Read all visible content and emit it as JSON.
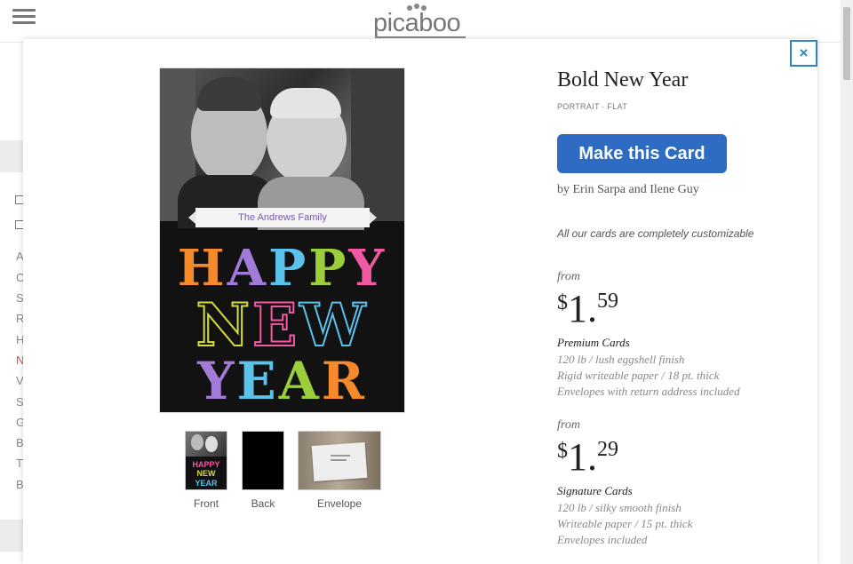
{
  "header": {
    "logo_text": "picaboo"
  },
  "sidebar_fragments": [
    "A",
    "C",
    "S",
    "R",
    "H",
    "N",
    "V",
    "S",
    "G",
    "B",
    "T",
    "B"
  ],
  "modal": {
    "close_label": "×",
    "card": {
      "family_banner": "The Andrews Family",
      "line1": "HAPPY",
      "line2": "NEW",
      "line3": "YEAR",
      "line1_colors": [
        "#f58a2d",
        "#a27bd9",
        "#5bc2ec",
        "#9ccd3a",
        "#ef5aa3"
      ],
      "line2_colors": [
        "#d6dd3a",
        "#ef5aa3",
        "#5bc2ec"
      ],
      "line3_colors": [
        "#a27bd9",
        "#5bc2ec",
        "#9ccd3a",
        "#f58a2d"
      ]
    },
    "thumbnails": [
      {
        "label": "Front"
      },
      {
        "label": "Back"
      },
      {
        "label": "Envelope"
      }
    ],
    "product": {
      "title": "Bold New Year",
      "subtitle": "PORTRAIT · FLAT",
      "cta_label": "Make this Card",
      "byline": "by Erin Sarpa and Ilene Guy",
      "custom_note": "All our cards are completely customizable"
    },
    "tiers": [
      {
        "from_label": "from",
        "currency": "$",
        "price_whole": "1",
        "price_dot": ".",
        "price_cents": "59",
        "name": "Premium Cards",
        "features": [
          "120 lb / lush eggshell finish",
          "Rigid writeable paper / 18 pt. thick",
          "Envelopes with return address included"
        ]
      },
      {
        "from_label": "from",
        "currency": "$",
        "price_whole": "1",
        "price_dot": ".",
        "price_cents": "29",
        "name": "Signature Cards",
        "features": [
          "120 lb / silky smooth finish",
          "Writeable paper / 15 pt. thick",
          "Envelopes included"
        ]
      }
    ]
  },
  "colors": {
    "accent": "#2e6bc2",
    "close_border": "#2f84c2",
    "banner_text": "#7b57b3"
  }
}
